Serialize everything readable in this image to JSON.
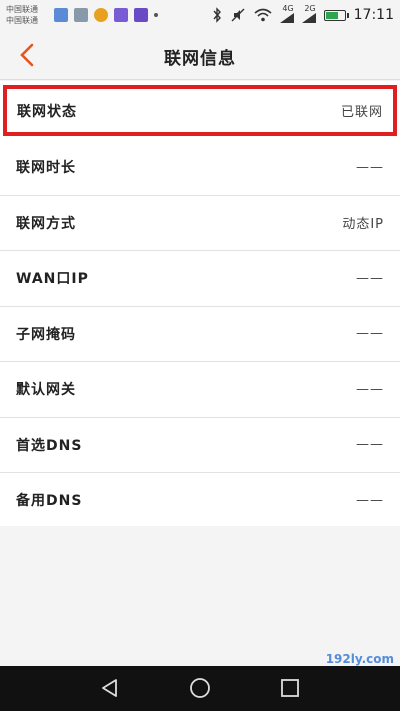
{
  "status_bar": {
    "carrier_1": "中国联通",
    "carrier_2": "中国联通",
    "network_1": "4G",
    "network_2": "2G",
    "time": "17:11",
    "battery_level": 0.7,
    "battery_color": "#2ea44f",
    "icons": [
      "wifi-icon",
      "bluetooth-icon",
      "silent-icon",
      "signal-icon"
    ]
  },
  "header": {
    "title": "联网信息",
    "back_icon": "chevron-left-icon",
    "accent": "#e8541e"
  },
  "rows": [
    {
      "label": "联网状态",
      "value": "已联网"
    },
    {
      "label": "联网时长",
      "value": "——"
    },
    {
      "label": "联网方式",
      "value": "动态IP"
    },
    {
      "label": "WAN口IP",
      "value": "——"
    },
    {
      "label": "子网掩码",
      "value": "——"
    },
    {
      "label": "默认网关",
      "value": "——"
    },
    {
      "label": "首选DNS",
      "value": "——"
    },
    {
      "label": "备用DNS",
      "value": "——"
    }
  ],
  "highlight_color": "#e02020",
  "watermark": "192ly.com",
  "nav": {
    "back": "triangle-back-icon",
    "home": "circle-home-icon",
    "recent": "square-recent-icon"
  }
}
